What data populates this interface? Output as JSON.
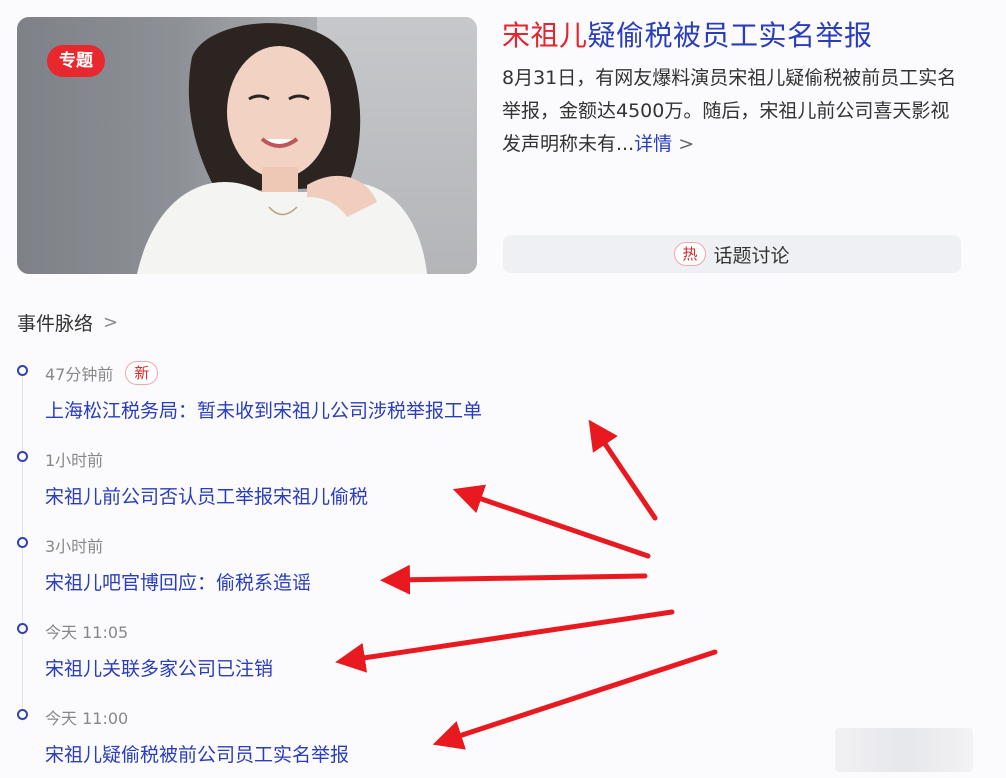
{
  "hero": {
    "tag": "专题",
    "title_highlight": "宋祖儿",
    "title_rest": "疑偷税被员工实名举报",
    "summary": "8月31日，有网友爆料演员宋祖儿疑偷税被前员工实名举报，金额达4500万。随后，宋祖儿前公司喜天影视发声明称未有...",
    "more_label": "详情",
    "more_chevron": ">"
  },
  "topic": {
    "hot_badge": "热",
    "label": "话题讨论"
  },
  "timeline": {
    "title": "事件脉络",
    "title_chevron": ">",
    "new_badge": "新",
    "events": [
      {
        "time": "47分钟前",
        "headline": "上海松江税务局：暂未收到宋祖儿公司涉税举报工单"
      },
      {
        "time": "1小时前",
        "headline": "宋祖儿前公司否认员工举报宋祖儿偷税"
      },
      {
        "time": "3小时前",
        "headline": "宋祖儿吧官博回应：偷税系造谣"
      },
      {
        "time": "今天 11:05",
        "headline": "宋祖儿关联多家公司已注销"
      },
      {
        "time": "今天 11:00",
        "headline": "宋祖儿疑偷税被前公司员工实名举报"
      }
    ]
  },
  "colors": {
    "link": "#2a3dbd",
    "accent_red": "#e3262d",
    "arrow_red": "#e8191f"
  }
}
